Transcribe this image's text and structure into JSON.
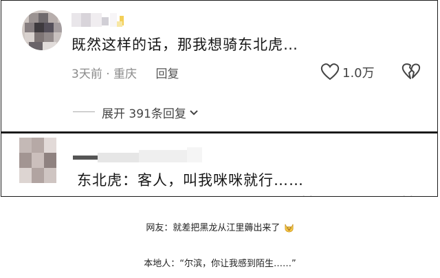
{
  "comment1": {
    "text": "既然这样的话，那我想骑东北虎…",
    "time_location": "3天前 · 重庆",
    "reply_label": "回复",
    "like_count": "1.0万",
    "expand_label": "展开 391条回复"
  },
  "comment2": {
    "text": "东北虎：客人，叫我咪咪就行……"
  },
  "captions": {
    "line1": "网友：就差把黑龙从江里薅出来了",
    "line2": "本地人：“尔滨，你让我感到陌生……”"
  },
  "icons": {
    "like": "heart-outline-icon",
    "dislike": "broken-heart-icon",
    "expand": "chevron-down-icon",
    "emoji": "laughing-cat-emoji-icon"
  },
  "colors": {
    "text": "#161616",
    "meta": "#8a8a8a",
    "border": "#1a1a1a"
  }
}
